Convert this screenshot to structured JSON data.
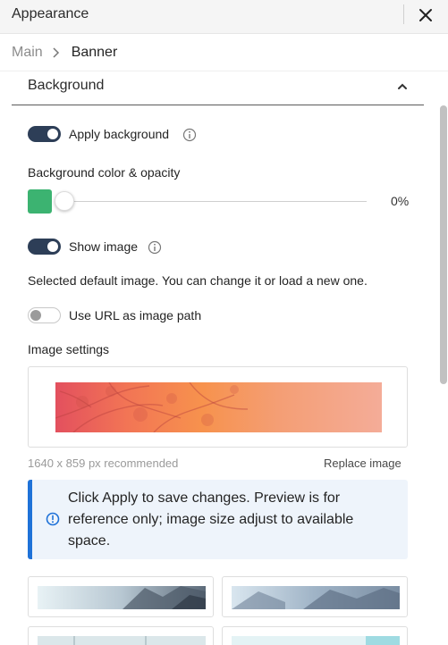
{
  "window": {
    "title": "Appearance",
    "close_icon": "close-icon"
  },
  "breadcrumb": {
    "parent": "Main",
    "current": "Banner"
  },
  "section": {
    "title": "Background",
    "expanded": true
  },
  "apply_background": {
    "label": "Apply background",
    "on": true
  },
  "color_opacity": {
    "label": "Background color & opacity",
    "color": "#3cb371",
    "opacity_value": "0%",
    "opacity_fraction": 0
  },
  "show_image": {
    "label": "Show image",
    "on": true
  },
  "selected_default_text": "Selected default image. You can change it or load a new one.",
  "use_url": {
    "label": "Use URL as image path",
    "on": false
  },
  "image_settings": {
    "label": "Image settings",
    "recommended": "1640 x 859 px recommended",
    "replace_label": "Replace image"
  },
  "notice": {
    "text": "Click Apply to save changes. Preview is for reference only; image size adjust to available space.",
    "accent_color": "#1f72d8"
  },
  "gallery": {
    "items": [
      "city-skyline-thumbnail",
      "building-towers-thumbnail",
      "office-thumbnail",
      "sky-thumbnail"
    ]
  }
}
